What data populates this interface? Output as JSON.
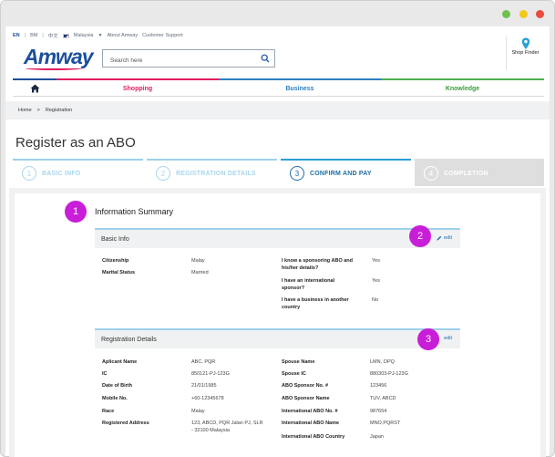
{
  "window": {
    "controls": [
      "minimize",
      "maximize",
      "close"
    ]
  },
  "utility_bar": {
    "languages": [
      "EN",
      "BM",
      "中文"
    ],
    "active_language": "EN",
    "country": "Malaysia",
    "about": "About Amway",
    "support": "Customer Support"
  },
  "header": {
    "logo": "Amway",
    "search_placeholder": "Search here",
    "shop_finder": "Shop Finder"
  },
  "nav": {
    "home_icon": "home-icon",
    "items": [
      "Shopping",
      "Business",
      "Knowledge"
    ],
    "colors": {
      "shopping": "#e31c5f",
      "business": "#2a7fc1",
      "knowledge": "#3c9c3f"
    }
  },
  "breadcrumb": {
    "home": "Home",
    "separator": ">",
    "current": "Registration"
  },
  "page_title": "Register as an ABO",
  "steps": [
    {
      "num": "1",
      "label": "BASIC INFO",
      "state": "done"
    },
    {
      "num": "2",
      "label": "REGISTRATION DETAILS",
      "state": "done"
    },
    {
      "num": "3",
      "label": "CONFIRM AND PAY",
      "state": "active"
    },
    {
      "num": "4",
      "label": "COMPLETION",
      "state": "disabled"
    }
  ],
  "markers": [
    "1",
    "2",
    "3"
  ],
  "summary": {
    "title": "Information Summary",
    "basic_info": {
      "heading": "Basic Info",
      "edit": "edit",
      "left": [
        {
          "k": "Citizenship",
          "v": "Malay"
        },
        {
          "k": "Marital Status",
          "v": "Married"
        }
      ],
      "right": [
        {
          "k": "I know a sponsoring ABO and his/her details?",
          "v": "Yes"
        },
        {
          "k": "I have an international sponsor?",
          "v": "Yes"
        },
        {
          "k": "I have a business in another country",
          "v": "No"
        }
      ]
    },
    "registration": {
      "heading": "Registration Details",
      "edit": "edit",
      "left": [
        {
          "k": "Aplicant Name",
          "v": "ABC, PQR"
        },
        {
          "k": "IC",
          "v": "850121-PJ-123G"
        },
        {
          "k": "Date of Birth",
          "v": "21/01/1985"
        },
        {
          "k": "Mobile No.",
          "v": "+60-12345678"
        },
        {
          "k": "Race",
          "v": "Malay"
        },
        {
          "k": "Registered Address",
          "v": "123, ABCD, PQR Jalan PJ, SLR - 32100 Malaysia"
        }
      ],
      "right": [
        {
          "k": "Spouse Name",
          "v": "LMN, OPQ"
        },
        {
          "k": "Spouse IC",
          "v": "880303-PJ-123G"
        },
        {
          "k": "ABO Sponsor No. #",
          "v": "123456"
        },
        {
          "k": "ABO Sponsor Name",
          "v": "TUV, ABCD"
        },
        {
          "k": "International ABO No. #",
          "v": "987654"
        },
        {
          "k": "International ABO Name",
          "v": "MNO,PQRST"
        },
        {
          "k": "International ABO Country",
          "v": "Japan"
        }
      ]
    }
  }
}
